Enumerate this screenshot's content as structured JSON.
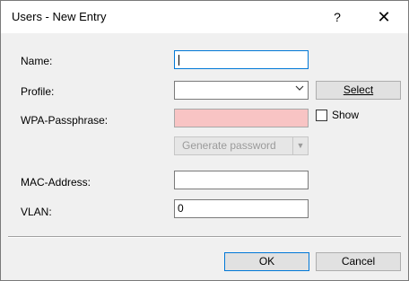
{
  "window": {
    "title": "Users - New Entry",
    "help": "?",
    "close": "✕"
  },
  "form": {
    "name_label": "Name:",
    "name_value": "",
    "profile_label": "Profile:",
    "profile_value": "",
    "select_button": "Select",
    "wpa_label": "WPA-Passphrase:",
    "wpa_value": "",
    "show_label": "Show",
    "generate_button": "Generate password",
    "mac_label": "MAC-Address:",
    "mac_value": "",
    "vlan_label": "VLAN:",
    "vlan_value": "0"
  },
  "footer": {
    "ok": "OK",
    "cancel": "Cancel"
  },
  "colors": {
    "focus_border": "#0078d7",
    "error_field_bg": "#f8c4c4"
  },
  "icons": {
    "profile_dropdown": "chevron-down-icon",
    "generate_dropdown": "triangle-down-icon"
  }
}
